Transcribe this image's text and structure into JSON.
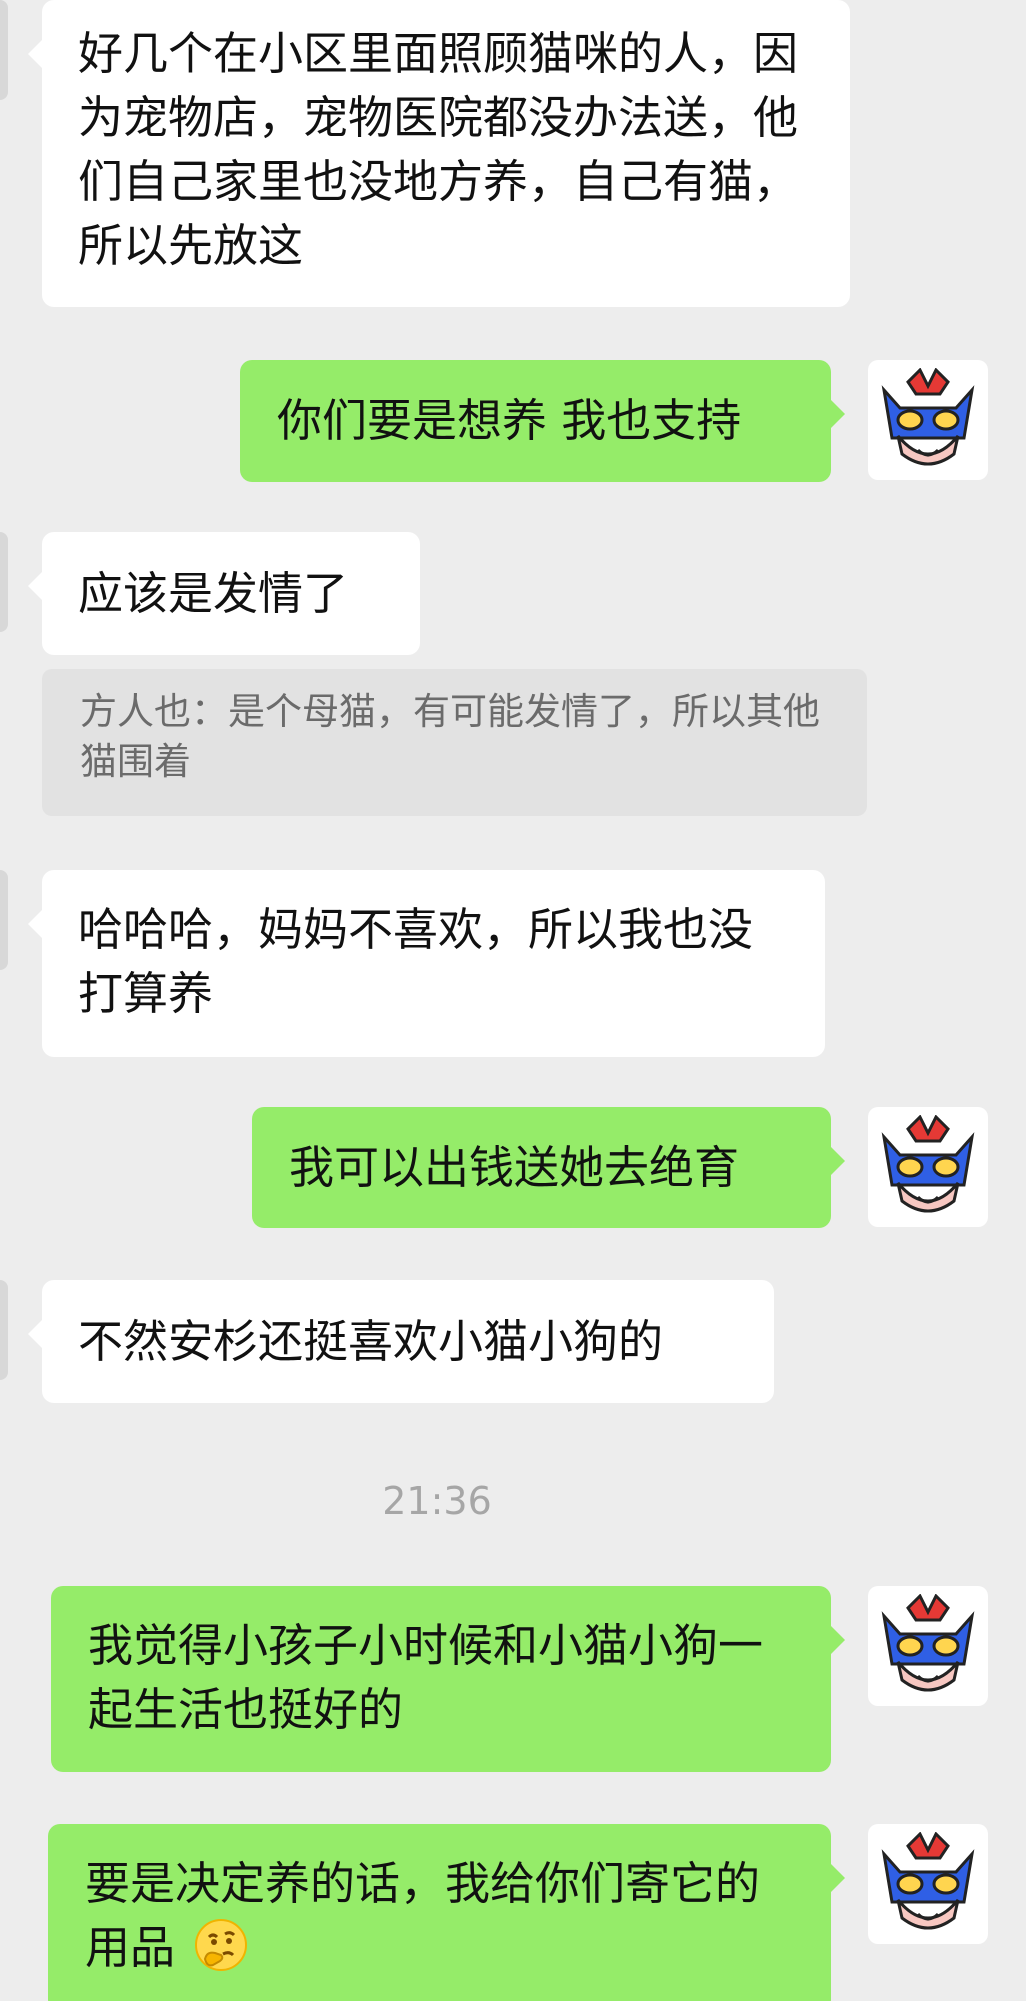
{
  "messages": [
    {
      "text": "好几个在小区里面照顾猫咪的人，因为宠物店，宠物医院都没办法送，他们自己家里也没地方养，自己有猫，所以先放这"
    },
    {
      "text": "你们要是想养 我也支持"
    },
    {
      "text": "应该是发情了"
    },
    {
      "text": "方人也：是个母猫，有可能发情了，所以其他猫围着"
    },
    {
      "text": "哈哈哈，妈妈不喜欢，所以我也没打算养"
    },
    {
      "text": "我可以出钱送她去绝育"
    },
    {
      "text": "不然安杉还挺喜欢小猫小狗的"
    },
    {
      "text": "21:36"
    },
    {
      "text": "我觉得小孩子小时候和小猫小狗一起生活也挺好的"
    },
    {
      "text": "要是决定养的话，我给你们寄它的用品",
      "emoji": "thinking-face-emoji"
    }
  ],
  "colors": {
    "background": "#ededed",
    "incoming_bubble": "#ffffff",
    "outgoing_bubble": "#95ec69",
    "quote_bubble": "#e2e2e2",
    "quote_text": "#6b6b6b",
    "timestamp_text": "#a6a6a6"
  },
  "icons": {
    "avatar": "cartoon-masked-hero-avatar-icon",
    "emoji": "thinking-face-emoji"
  }
}
